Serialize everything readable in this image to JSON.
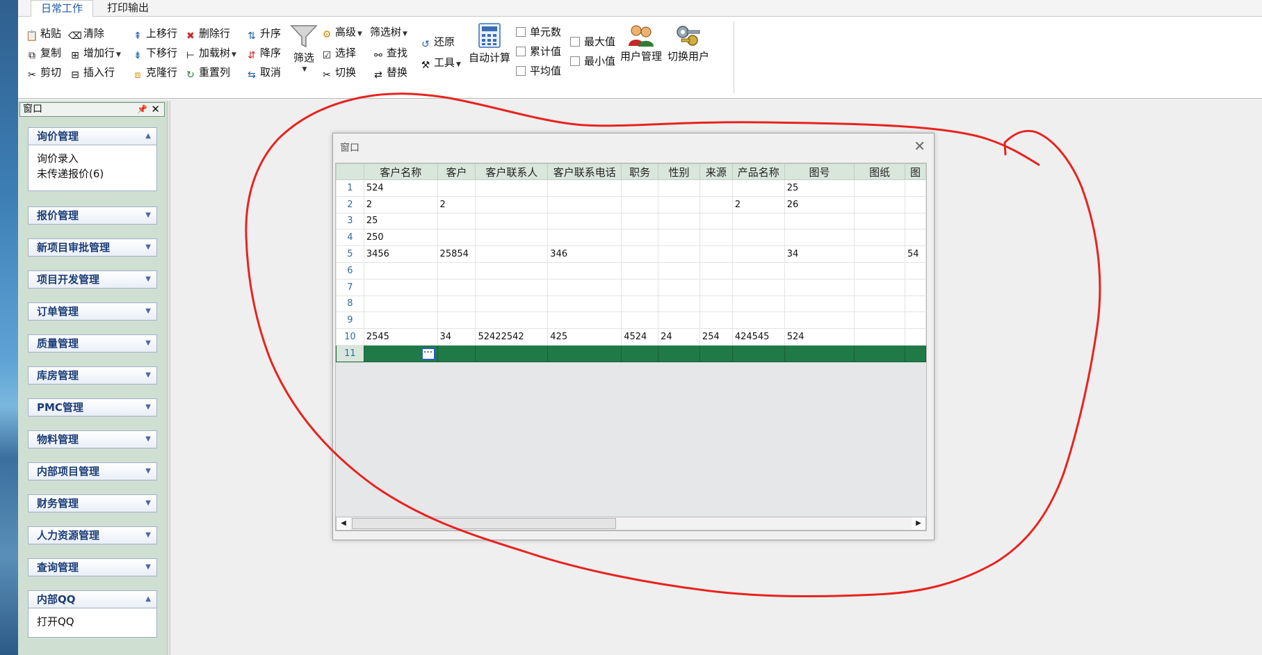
{
  "ribbon_tabs": [
    "日常工作",
    "打印输出"
  ],
  "ribbon": {
    "paste": "粘贴",
    "clear": "清除",
    "copy": "复制",
    "add_row": "增加行",
    "cut": "剪切",
    "insert_row": "插入行",
    "move_up": "上移行",
    "delete_row": "删除行",
    "move_down": "下移行",
    "load_tree": "加载树",
    "clone_row": "克隆行",
    "reset_col": "重置列",
    "sort_asc": "升序",
    "sort_desc": "降序",
    "cancel": "取消",
    "filter": "筛选",
    "advanced": "高级",
    "filter_tree": "筛选树",
    "select": "选择",
    "find": "查找",
    "switch": "切换",
    "replace": "替换",
    "restore": "还原",
    "tools": "工具",
    "auto_calc": "自动计算",
    "cell_count": "单元数",
    "cumulative": "累计值",
    "average": "平均值",
    "max": "最大值",
    "min": "最小值",
    "user_mgmt": "用户管理",
    "switch_user": "切换用户"
  },
  "left_panel": {
    "title": "窗口",
    "groups": [
      {
        "label": "询价管理",
        "expanded": true,
        "items": [
          "询价录入",
          "未传递报价(6)"
        ]
      },
      {
        "label": "报价管理",
        "expanded": false
      },
      {
        "label": "新项目审批管理",
        "expanded": false
      },
      {
        "label": "项目开发管理",
        "expanded": false
      },
      {
        "label": "订单管理",
        "expanded": false
      },
      {
        "label": "质量管理",
        "expanded": false
      },
      {
        "label": "库房管理",
        "expanded": false
      },
      {
        "label": "PMC管理",
        "expanded": false
      },
      {
        "label": "物料管理",
        "expanded": false
      },
      {
        "label": "内部项目管理",
        "expanded": false
      },
      {
        "label": "财务管理",
        "expanded": false
      },
      {
        "label": "人力资源管理",
        "expanded": false
      },
      {
        "label": "查询管理",
        "expanded": false
      },
      {
        "label": "内部QQ",
        "expanded": true,
        "items": [
          "打开QQ"
        ]
      }
    ]
  },
  "dialog": {
    "title": "窗口",
    "columns": [
      "客户名称",
      "客户",
      "客户联系人",
      "客户联系电话",
      "职务",
      "性别",
      "来源",
      "产品名称",
      "图号",
      "图纸",
      "图"
    ],
    "rows": [
      {
        "n": "1",
        "cells": [
          "524",
          "",
          "",
          "",
          "",
          "",
          "",
          "",
          "25",
          "",
          ""
        ]
      },
      {
        "n": "2",
        "cells": [
          "2",
          "2",
          "",
          "",
          "",
          "",
          "",
          "2",
          "26",
          "",
          ""
        ]
      },
      {
        "n": "3",
        "cells": [
          "25",
          "",
          "",
          "",
          "",
          "",
          "",
          "",
          "",
          "",
          ""
        ]
      },
      {
        "n": "4",
        "cells": [
          "250",
          "",
          "",
          "",
          "",
          "",
          "",
          "",
          "",
          "",
          ""
        ]
      },
      {
        "n": "5",
        "cells": [
          "3456",
          "25854",
          "",
          "346",
          "",
          "",
          "",
          "",
          "34",
          "",
          "54"
        ]
      },
      {
        "n": "6",
        "cells": [
          "",
          "",
          "",
          "",
          "",
          "",
          "",
          "",
          "",
          "",
          ""
        ]
      },
      {
        "n": "7",
        "cells": [
          "",
          "",
          "",
          "",
          "",
          "",
          "",
          "",
          "",
          "",
          ""
        ]
      },
      {
        "n": "8",
        "cells": [
          "",
          "",
          "",
          "",
          "",
          "",
          "",
          "",
          "",
          "",
          ""
        ]
      },
      {
        "n": "9",
        "cells": [
          "",
          "",
          "",
          "",
          "",
          "",
          "",
          "",
          "",
          "",
          ""
        ]
      },
      {
        "n": "10",
        "cells": [
          "2545",
          "34",
          "52422542",
          "425",
          "4524",
          "24",
          "254",
          "424545",
          "524",
          "",
          ""
        ]
      },
      {
        "n": "11",
        "cells": [
          "",
          "",
          "",
          "",
          "",
          "",
          "",
          "",
          "",
          "",
          ""
        ],
        "selected": true
      }
    ]
  },
  "colors": {
    "accent": "#1e5aa8",
    "selected_row": "#1f7a47",
    "annotation": "#e8231f"
  }
}
